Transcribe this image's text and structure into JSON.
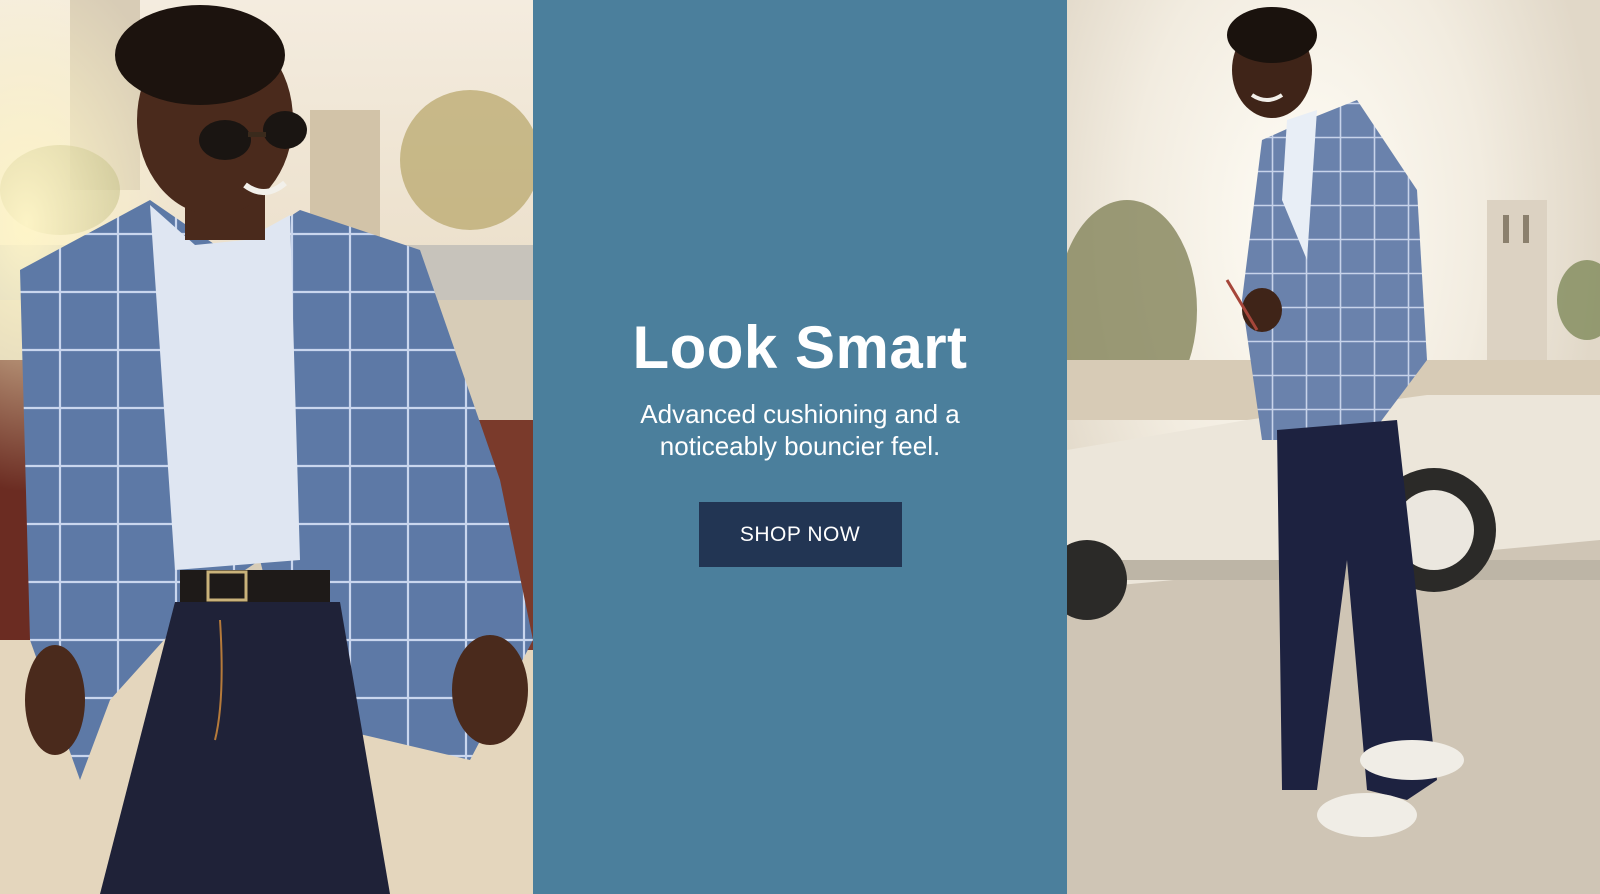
{
  "hero": {
    "headline": "Look Smart",
    "subhead": "Advanced cushioning and a noticeably bouncier feel.",
    "cta_label": "SHOP NOW"
  },
  "colors": {
    "panel": "#4b7f9c",
    "button": "#223553",
    "text": "#ffffff"
  }
}
